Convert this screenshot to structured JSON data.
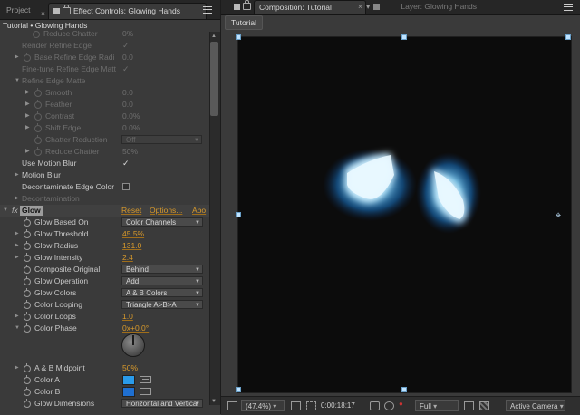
{
  "left_panel": {
    "tabs": {
      "project": "Project",
      "effect_controls": "Effect Controls: Glowing Hands"
    },
    "breadcrumb": "Tutorial • Glowing Hands",
    "rows": [
      {
        "name": "Reduce Chatter",
        "value": "0%"
      },
      {
        "name": "Render Refine Edge",
        "value": "✓"
      },
      {
        "name": "Base Refine Edge Radi",
        "value": "0.0"
      },
      {
        "name": "Fine-tune Refine Edge Matt",
        "value": "✓"
      },
      {
        "name": "Refine Edge Matte",
        "value": ""
      },
      {
        "name": "Smooth",
        "value": "0.0"
      },
      {
        "name": "Feather",
        "value": "0.0"
      },
      {
        "name": "Contrast",
        "value": "0.0%"
      },
      {
        "name": "Shift Edge",
        "value": "0.0%"
      },
      {
        "name": "Chatter Reduction",
        "value": "Off"
      },
      {
        "name": "Reduce Chatter",
        "value": "50%"
      },
      {
        "name": "Use Motion Blur",
        "value": "✓"
      },
      {
        "name": "Motion Blur",
        "value": ""
      },
      {
        "name": "Decontaminate Edge Color",
        "value": ""
      },
      {
        "name": "Decontamination",
        "value": ""
      }
    ],
    "glow": {
      "fx": "fx",
      "label": "Glow",
      "reset": "Reset",
      "options": "Options...",
      "about": "Abo",
      "rows": [
        {
          "name": "Glow Based On",
          "value": "Color Channels"
        },
        {
          "name": "Glow Threshold",
          "value": "45.5%"
        },
        {
          "name": "Glow Radius",
          "value": "131.0"
        },
        {
          "name": "Glow Intensity",
          "value": "2.4"
        },
        {
          "name": "Composite Original",
          "value": "Behind"
        },
        {
          "name": "Glow Operation",
          "value": "Add"
        },
        {
          "name": "Glow Colors",
          "value": "A & B Colors"
        },
        {
          "name": "Color Looping",
          "value": "Triangle A>B>A"
        },
        {
          "name": "Color Loops",
          "value": "1.0"
        },
        {
          "name": "Color Phase",
          "value": "0x+0.0°"
        },
        {
          "name": "A & B Midpoint",
          "value": "50%"
        },
        {
          "name": "Color A",
          "value": ""
        },
        {
          "name": "Color B",
          "value": ""
        },
        {
          "name": "Glow Dimensions",
          "value": "Horizontal and Vertical"
        }
      ]
    },
    "colors": {
      "color_a": "#2a9bea",
      "color_b": "#1f6fd0",
      "link": "#d99a2b"
    }
  },
  "right_panel": {
    "tabs": {
      "composition": "Composition: Tutorial",
      "layer": "Layer: Glowing Hands"
    },
    "comp_subtab": "Tutorial",
    "bottom_bar": {
      "zoom": "(47.4%)",
      "timecode": "0:00:18:17",
      "resolution": "Full",
      "camera": "Active Camera"
    }
  }
}
